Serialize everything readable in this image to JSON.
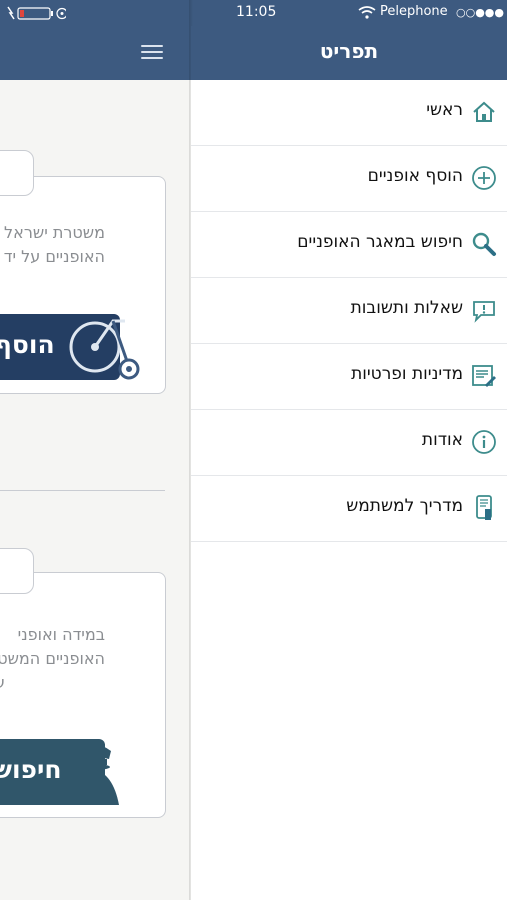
{
  "status_bar": {
    "time": "11:05",
    "carrier": "Pelephone",
    "signal": "○○●●●"
  },
  "drawer": {
    "title": "תפריט",
    "items": [
      {
        "label": "ראשי",
        "icon": "home-icon"
      },
      {
        "label": "הוסף אופניים",
        "icon": "plus-circle-icon"
      },
      {
        "label": "חיפוש במאגר האופניים",
        "icon": "search-icon"
      },
      {
        "label": "שאלות ותשובות",
        "icon": "speech-bubble-exclamation-icon"
      },
      {
        "label": "מדיניות ופרטיות",
        "icon": "document-edit-icon"
      },
      {
        "label": "אודות",
        "icon": "info-icon"
      },
      {
        "label": "מדריך למשתמש",
        "icon": "phone-guide-icon"
      }
    ]
  },
  "page": {
    "card1": {
      "text_line1": "משטרת ישראל",
      "text_line2": "האופניים על יד",
      "button_label": "הוסף"
    },
    "card2": {
      "text_line1": "במידה ואופני",
      "text_line2": "האופניים המשטר",
      "text_line3": "ע",
      "button_label": "חיפוש"
    }
  },
  "colors": {
    "header": "#3d5a80",
    "button_dark": "#243e63",
    "button_teal": "#30566a",
    "icon_teal": "#3d8c8c"
  }
}
